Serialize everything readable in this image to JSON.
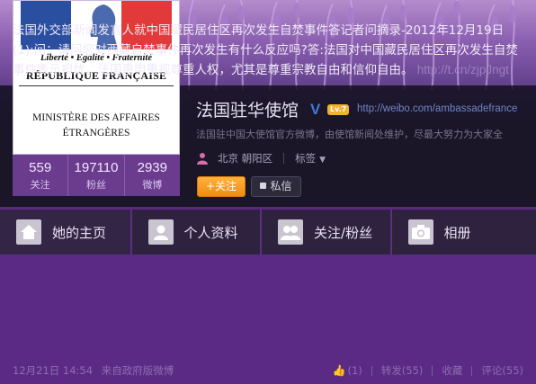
{
  "logo": {
    "motto": "Liberté • Egalité • Fraternité",
    "republic": "RÉPUBLIQUE FRANÇAISE",
    "ministry_line1": "MINISTÈRE DES AFFAIRES",
    "ministry_line2": "ÉTRANGÈRES"
  },
  "stats": [
    {
      "num": "559",
      "label": "关注"
    },
    {
      "num": "197110",
      "label": "粉丝"
    },
    {
      "num": "2939",
      "label": "微博"
    }
  ],
  "profile": {
    "name": "法国驻华使馆",
    "verified": "V",
    "level": "Lv.7",
    "url": "http://weibo.com/ambassadefrance",
    "description": "法国驻中国大使馆官方微博，由使馆新闻处维护，尽最大努力为大家全",
    "location": "北京 朝阳区",
    "tags": "标签"
  },
  "buttons": {
    "follow": "+关注",
    "message": "私信"
  },
  "nav": [
    {
      "label": "她的主页"
    },
    {
      "label": "个人资料"
    },
    {
      "label": "关注/粉丝"
    },
    {
      "label": "相册"
    }
  ],
  "post": {
    "text": "法国外交部新闻发言人就中国藏民居住区再次发生自焚事件答记者问摘录-2012年12月19日(1):问：请问您对西藏自焚事件再次发生有什么反应吗?答:法国对中国藏民居住区再次发生自焚事件表示担忧。法国重申重视尊重人权，尤其是尊重宗教自由和信仰自由。",
    "link": "http://t.cn/zjpJngt",
    "time": "12月21日 14:54",
    "source": "来自政府版微博",
    "like": "(1)",
    "repost": "转发(55)",
    "favorite": "收藏",
    "comment": "评论(55)"
  }
}
